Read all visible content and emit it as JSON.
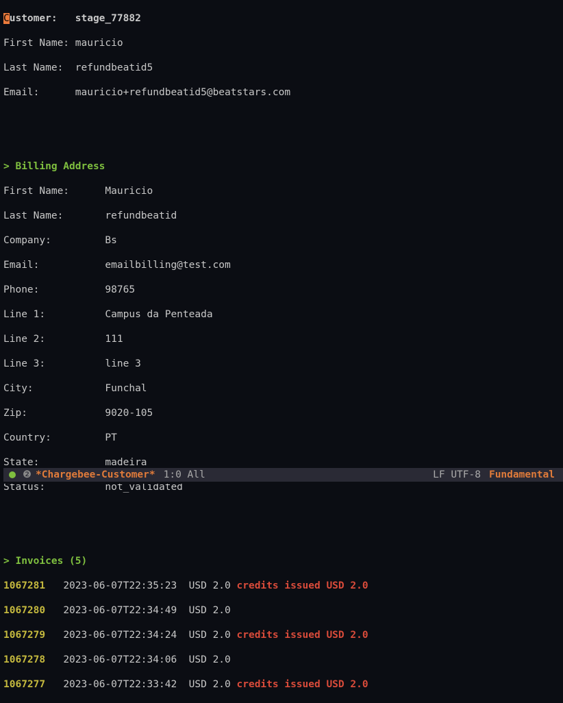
{
  "customer": {
    "header_label": "Customer:",
    "header_value": "stage_77882",
    "first_name_label": "First Name:",
    "first_name_value": "mauricio",
    "last_name_label": "Last Name:",
    "last_name_value": "refundbeatid5",
    "email_label": "Email:",
    "email_value": "mauricio+refundbeatid5@beatstars.com"
  },
  "billing": {
    "section_header": "> Billing Address",
    "first_name_label": "First Name:",
    "first_name_value": "Mauricio",
    "last_name_label": "Last Name:",
    "last_name_value": "refundbeatid",
    "company_label": "Company:",
    "company_value": "Bs",
    "email_label": "Email:",
    "email_value": "emailbilling@test.com",
    "phone_label": "Phone:",
    "phone_value": "98765",
    "line1_label": "Line 1:",
    "line1_value": "Campus da Penteada",
    "line2_label": "Line 2:",
    "line2_value": "111",
    "line3_label": "Line 3:",
    "line3_value": "line 3",
    "city_label": "City:",
    "city_value": "Funchal",
    "zip_label": "Zip:",
    "zip_value": "9020-105",
    "country_label": "Country:",
    "country_value": "PT",
    "state_label": "State:",
    "state_value": "madeira",
    "status_label": "Status:",
    "status_value": "not_validated"
  },
  "invoices": {
    "section_header": "> Invoices (5)",
    "rows": [
      {
        "id": "1067281",
        "ts": "2023-06-07T22:35:23",
        "amount": "USD 2.0",
        "credit": "credits issued USD 2.0"
      },
      {
        "id": "1067280",
        "ts": "2023-06-07T22:34:49",
        "amount": "USD 2.0",
        "credit": ""
      },
      {
        "id": "1067279",
        "ts": "2023-06-07T22:34:24",
        "amount": "USD 2.0",
        "credit": "credits issued USD 2.0"
      },
      {
        "id": "1067278",
        "ts": "2023-06-07T22:34:06",
        "amount": "USD 2.0",
        "credit": ""
      },
      {
        "id": "1067277",
        "ts": "2023-06-07T22:33:42",
        "amount": "USD 2.0",
        "credit": "credits issued USD 2.0"
      }
    ]
  },
  "modeline": {
    "buffer_name": "*Chargebee-Customer*",
    "position": "1:0 All",
    "encoding": "LF UTF-8",
    "mode": "Fundamental"
  }
}
